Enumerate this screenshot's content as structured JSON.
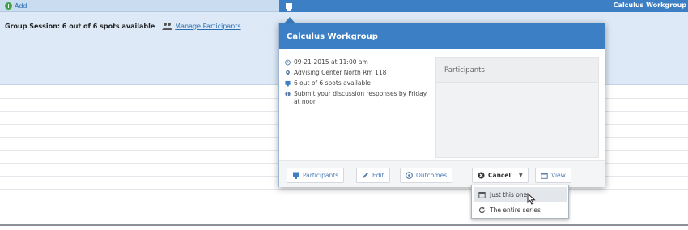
{
  "calendar": {
    "add_label": "Add",
    "session_status": "Group Session: 6 out of 6 spots available",
    "manage_label": "Manage Participants",
    "event_title": "Calculus Workgroup"
  },
  "popup": {
    "title": "Calculus Workgroup",
    "details": {
      "datetime": "09-21-2015 at 11:00 am",
      "location": "Advising Center North Rm 118",
      "spots": "6 out of 6 spots available",
      "note": "Submit your discussion responses by Friday at noon"
    },
    "participants_heading": "Participants",
    "actions": {
      "participants": "Participants",
      "edit": "Edit",
      "outcomes": "Outcomes",
      "cancel": "Cancel",
      "view": "View"
    }
  },
  "cancel_menu": {
    "items": [
      "Just this one",
      "The entire series"
    ]
  },
  "colors": {
    "header_blue": "#3d7fc4",
    "band_blue": "#dde9f6",
    "link_blue": "#2b6fb3",
    "add_green": "#41a24a"
  }
}
